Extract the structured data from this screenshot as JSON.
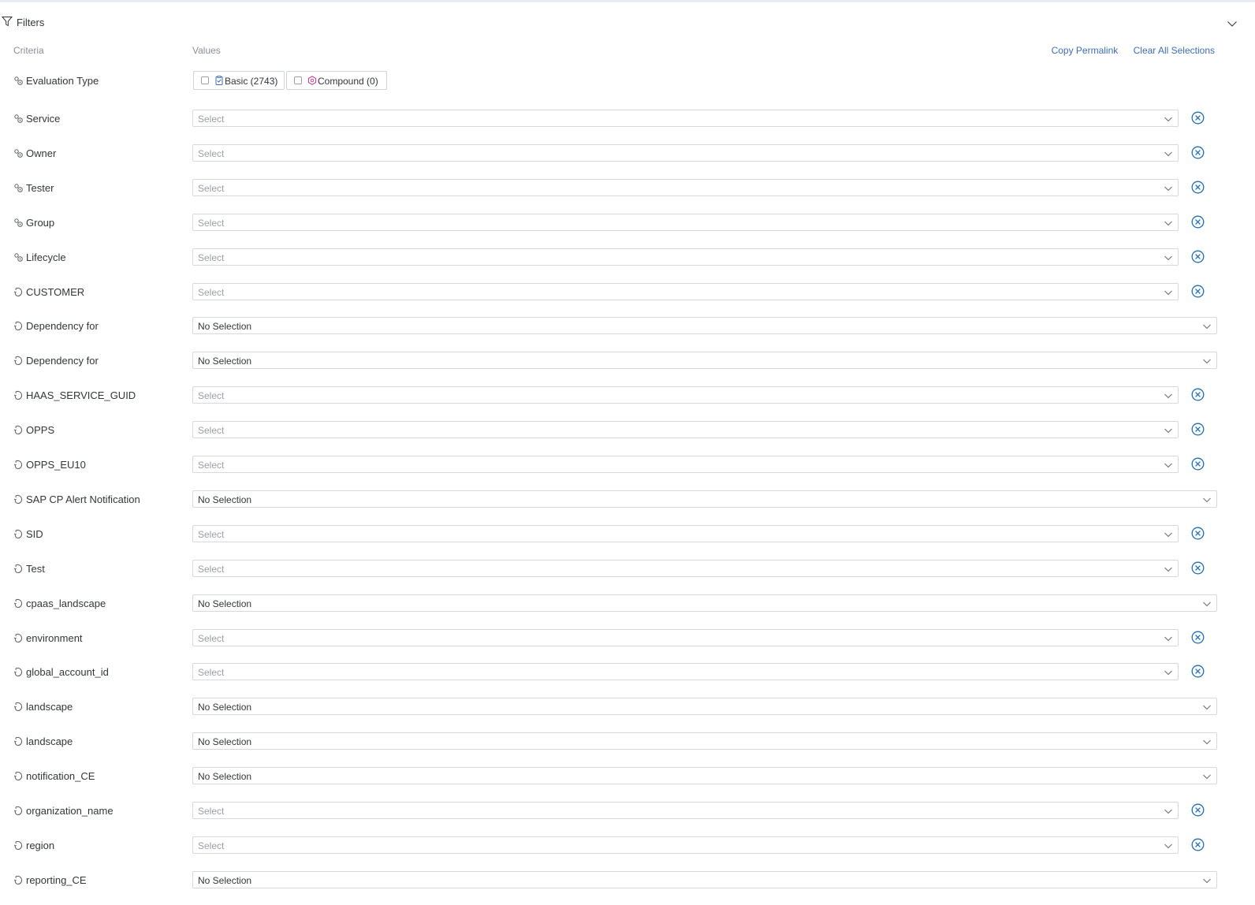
{
  "header": {
    "title": "Filters"
  },
  "columns": {
    "criteria": "Criteria",
    "values": "Values"
  },
  "actions": {
    "copy_permalink": "Copy Permalink",
    "clear_all": "Clear All Selections"
  },
  "evaluation_type": {
    "label": "Evaluation Type",
    "options": [
      {
        "label": "Basic (2743)",
        "checked": false
      },
      {
        "label": "Compound (0)",
        "checked": false
      }
    ]
  },
  "filters": [
    {
      "label": "Service",
      "icon": "gear-cluster-icon",
      "value": "Select",
      "placeholder": true,
      "clearable": true
    },
    {
      "label": "Owner",
      "icon": "gear-cluster-icon",
      "value": "Select",
      "placeholder": true,
      "clearable": true
    },
    {
      "label": "Tester",
      "icon": "gear-cluster-icon",
      "value": "Select",
      "placeholder": true,
      "clearable": true
    },
    {
      "label": "Group",
      "icon": "gear-cluster-icon",
      "value": "Select",
      "placeholder": true,
      "clearable": true
    },
    {
      "label": "Lifecycle",
      "icon": "gear-cluster-icon",
      "value": "Select",
      "placeholder": true,
      "clearable": true
    },
    {
      "label": "CUSTOMER",
      "icon": "tag-icon",
      "value": "Select",
      "placeholder": true,
      "clearable": true
    },
    {
      "label": "Dependency for",
      "icon": "tag-icon",
      "value": "No Selection",
      "placeholder": false,
      "clearable": false
    },
    {
      "label": "Dependency for",
      "icon": "tag-icon",
      "value": "No Selection",
      "placeholder": false,
      "clearable": false
    },
    {
      "label": "HAAS_SERVICE_GUID",
      "icon": "tag-icon",
      "value": "Select",
      "placeholder": true,
      "clearable": true
    },
    {
      "label": "OPPS",
      "icon": "tag-icon",
      "value": "Select",
      "placeholder": true,
      "clearable": true
    },
    {
      "label": "OPPS_EU10",
      "icon": "tag-icon",
      "value": "Select",
      "placeholder": true,
      "clearable": true
    },
    {
      "label": "SAP CP Alert Notification",
      "icon": "tag-icon",
      "value": "No Selection",
      "placeholder": false,
      "clearable": false
    },
    {
      "label": "SID",
      "icon": "tag-icon",
      "value": "Select",
      "placeholder": true,
      "clearable": true
    },
    {
      "label": "Test",
      "icon": "tag-icon",
      "value": "Select",
      "placeholder": true,
      "clearable": true
    },
    {
      "label": "cpaas_landscape",
      "icon": "tag-icon",
      "value": "No Selection",
      "placeholder": false,
      "clearable": false
    },
    {
      "label": "environment",
      "icon": "tag-icon",
      "value": "Select",
      "placeholder": true,
      "clearable": true
    },
    {
      "label": "global_account_id",
      "icon": "tag-icon",
      "value": "Select",
      "placeholder": true,
      "clearable": true
    },
    {
      "label": "landscape",
      "icon": "tag-icon",
      "value": "No Selection",
      "placeholder": false,
      "clearable": false
    },
    {
      "label": "landscape",
      "icon": "tag-icon",
      "value": "No Selection",
      "placeholder": false,
      "clearable": false
    },
    {
      "label": "notification_CE",
      "icon": "tag-icon",
      "value": "No Selection",
      "placeholder": false,
      "clearable": false
    },
    {
      "label": "organization_name",
      "icon": "tag-icon",
      "value": "Select",
      "placeholder": true,
      "clearable": true
    },
    {
      "label": "region",
      "icon": "tag-icon",
      "value": "Select",
      "placeholder": true,
      "clearable": true
    },
    {
      "label": "reporting_CE",
      "icon": "tag-icon",
      "value": "No Selection",
      "placeholder": false,
      "clearable": false
    }
  ],
  "colors": {
    "link": "#3b6fb6",
    "clear_icon": "#1d6fb8",
    "compound_icon": "#c2318e",
    "basic_icon": "#3b6fb6"
  }
}
